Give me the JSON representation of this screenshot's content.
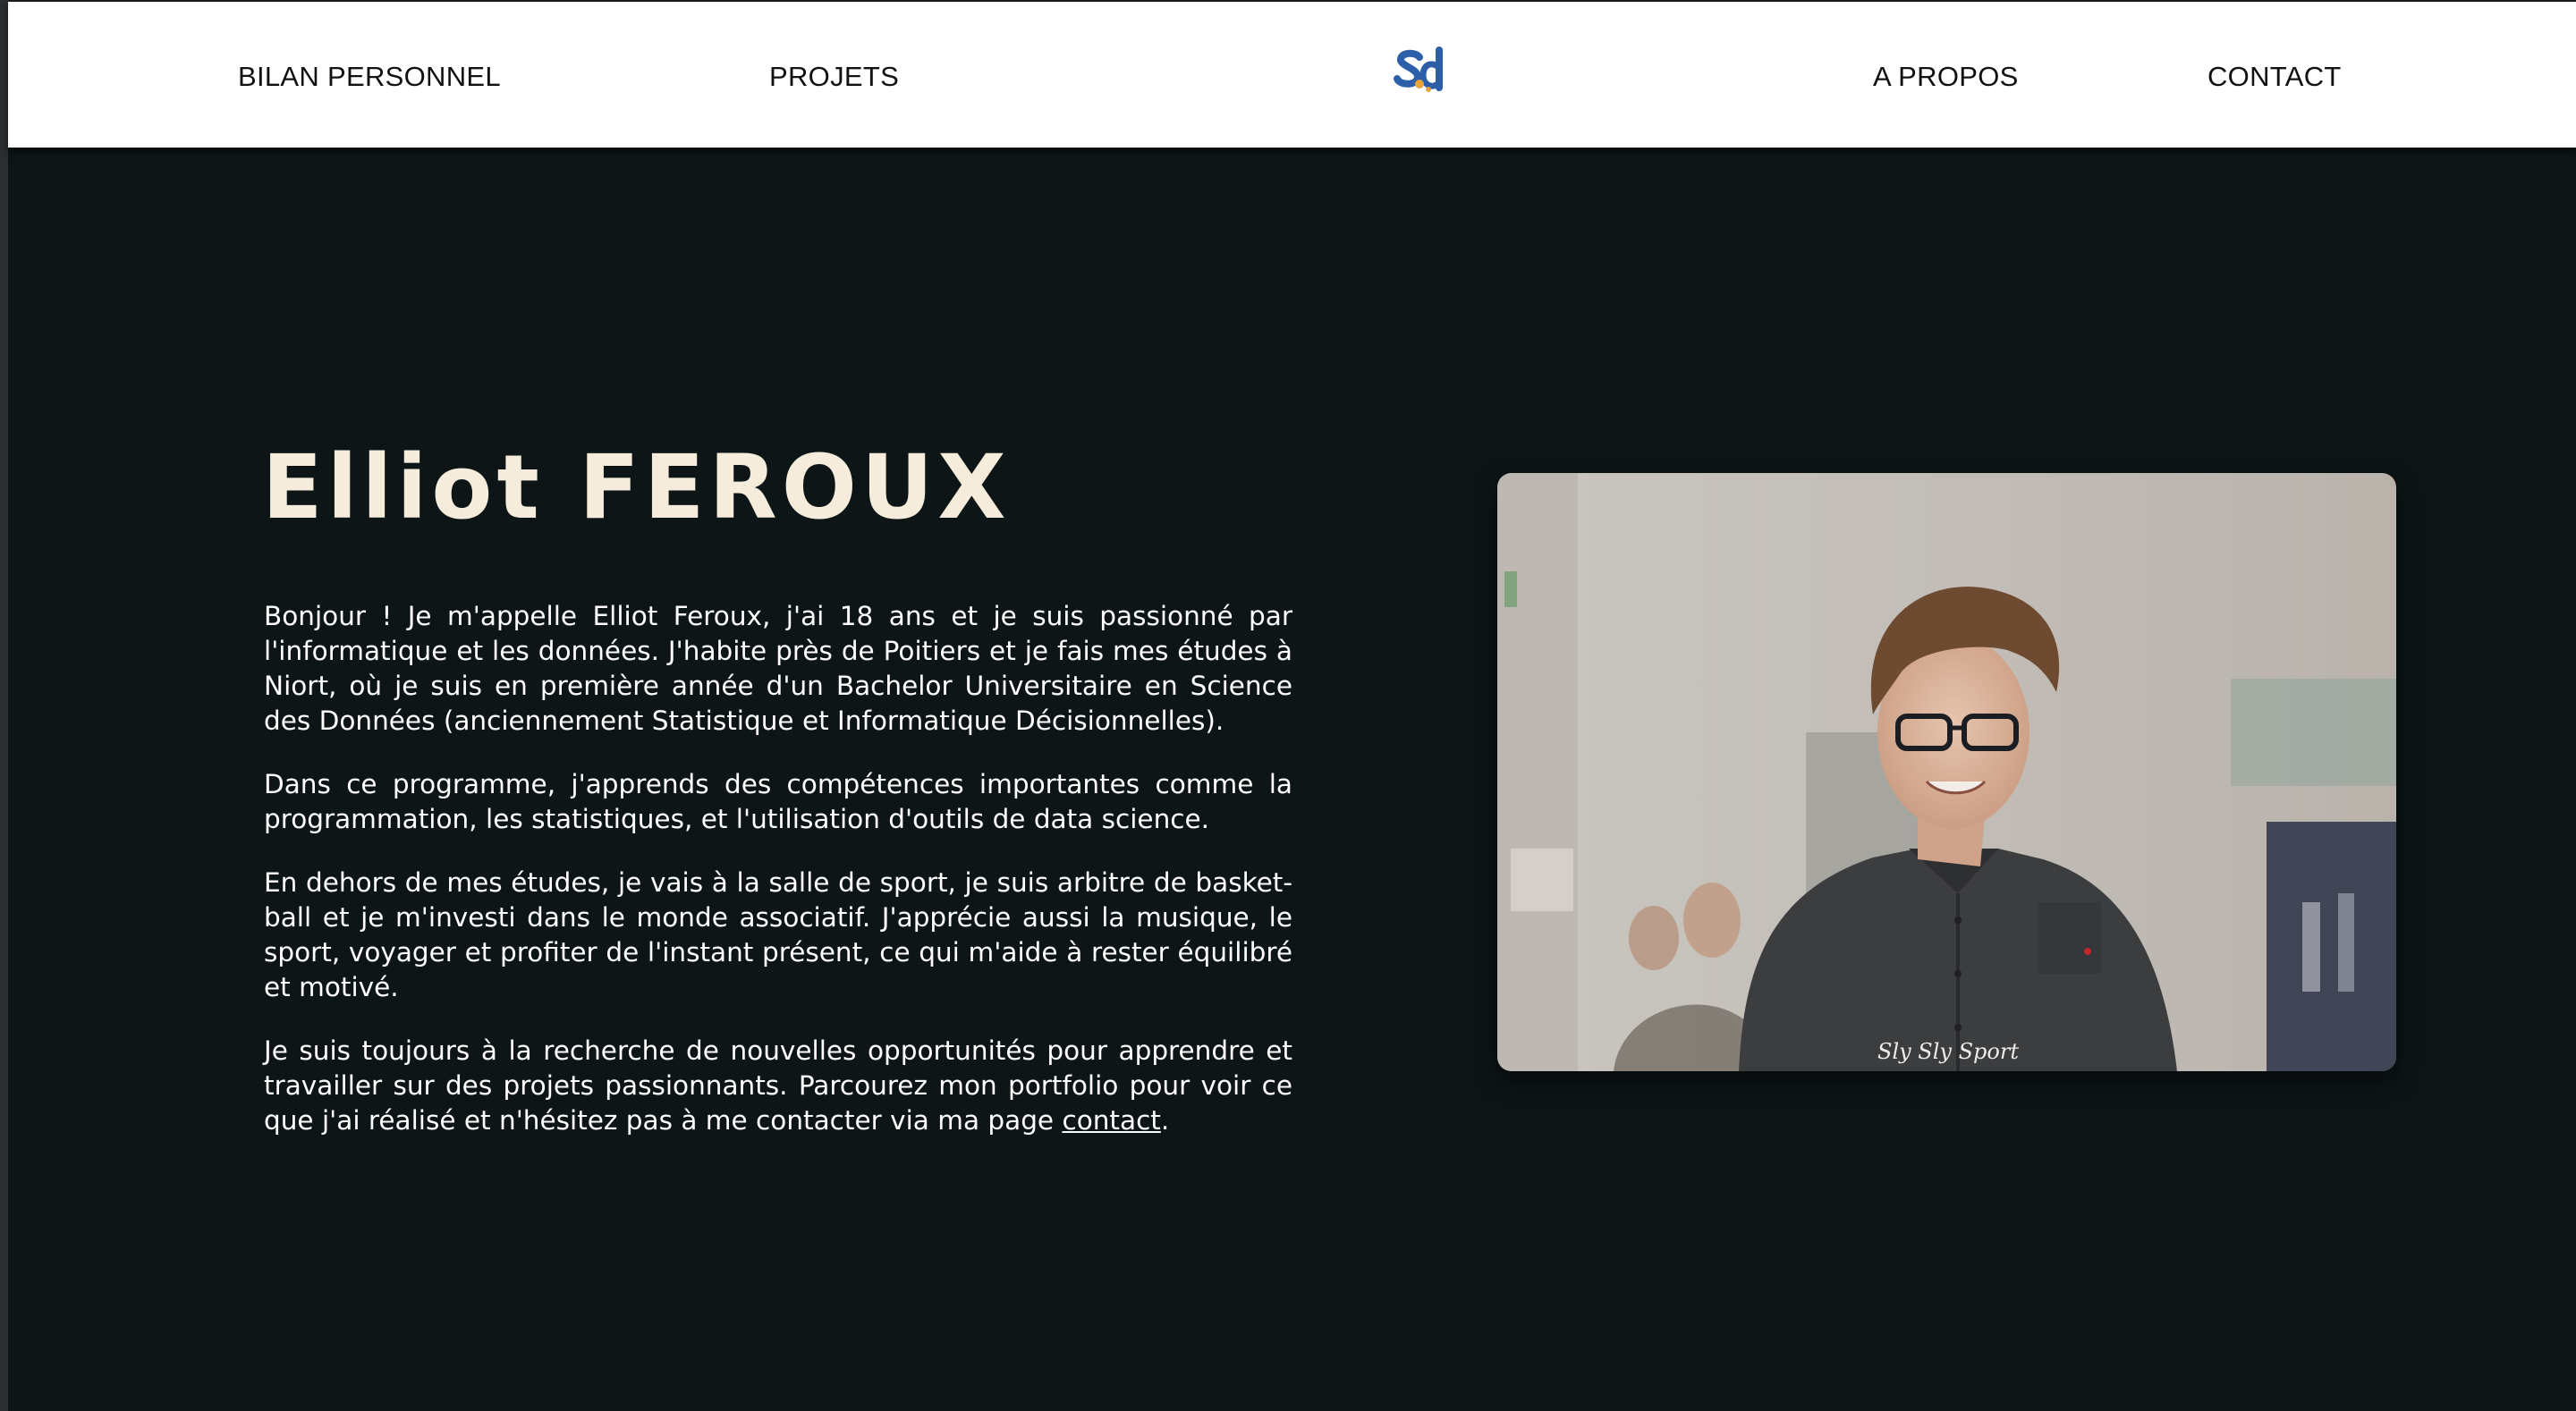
{
  "nav": {
    "bilan_label": "BILAN PERSONNEL",
    "projets_label": "PROJETS",
    "apropos_label": "A PROPOS",
    "contact_label": "CONTACT",
    "logo_icon": "sd-logo-icon"
  },
  "hero": {
    "name": "Elliot FEROUX",
    "paragraphs": [
      "Bonjour ! Je m'appelle Elliot Feroux, j'ai 18 ans et je suis passionné par l'informatique et les données. J'habite près de Poitiers et je fais mes études à Niort, où je suis en première année d'un Bachelor Universitaire en Science des Données (anciennement Statistique et Informatique Décisionnelles).",
      "Dans ce programme, j'apprends des compétences importantes comme la programmation, les statistiques, et l'utilisation d'outils de data science.",
      "En dehors de mes études, je vais à la salle de sport, je suis arbitre de basket-ball et je m'investi dans le monde associatif. J'apprécie aussi la musique, le sport, voyager et profiter de l'instant présent, ce qui m'aide à rester équilibré et motivé.",
      "Je suis toujours à la recherche de nouvelles opportunités pour apprendre et travailler sur des projets passionnants. Parcourez mon portfolio pour voir ce que j'ai réalisé et n'hésitez pas à me contacter via ma page "
    ],
    "contact_link": "contact",
    "final_period": ".",
    "photo_watermark": "Sly Sly Sport"
  },
  "colors": {
    "background": "#0d1516",
    "title": "#f5ecdc",
    "text": "#ffffff",
    "nav_bg": "#ffffff",
    "logo_blue": "#2c5fa8",
    "logo_orange": "#e8a33c"
  }
}
